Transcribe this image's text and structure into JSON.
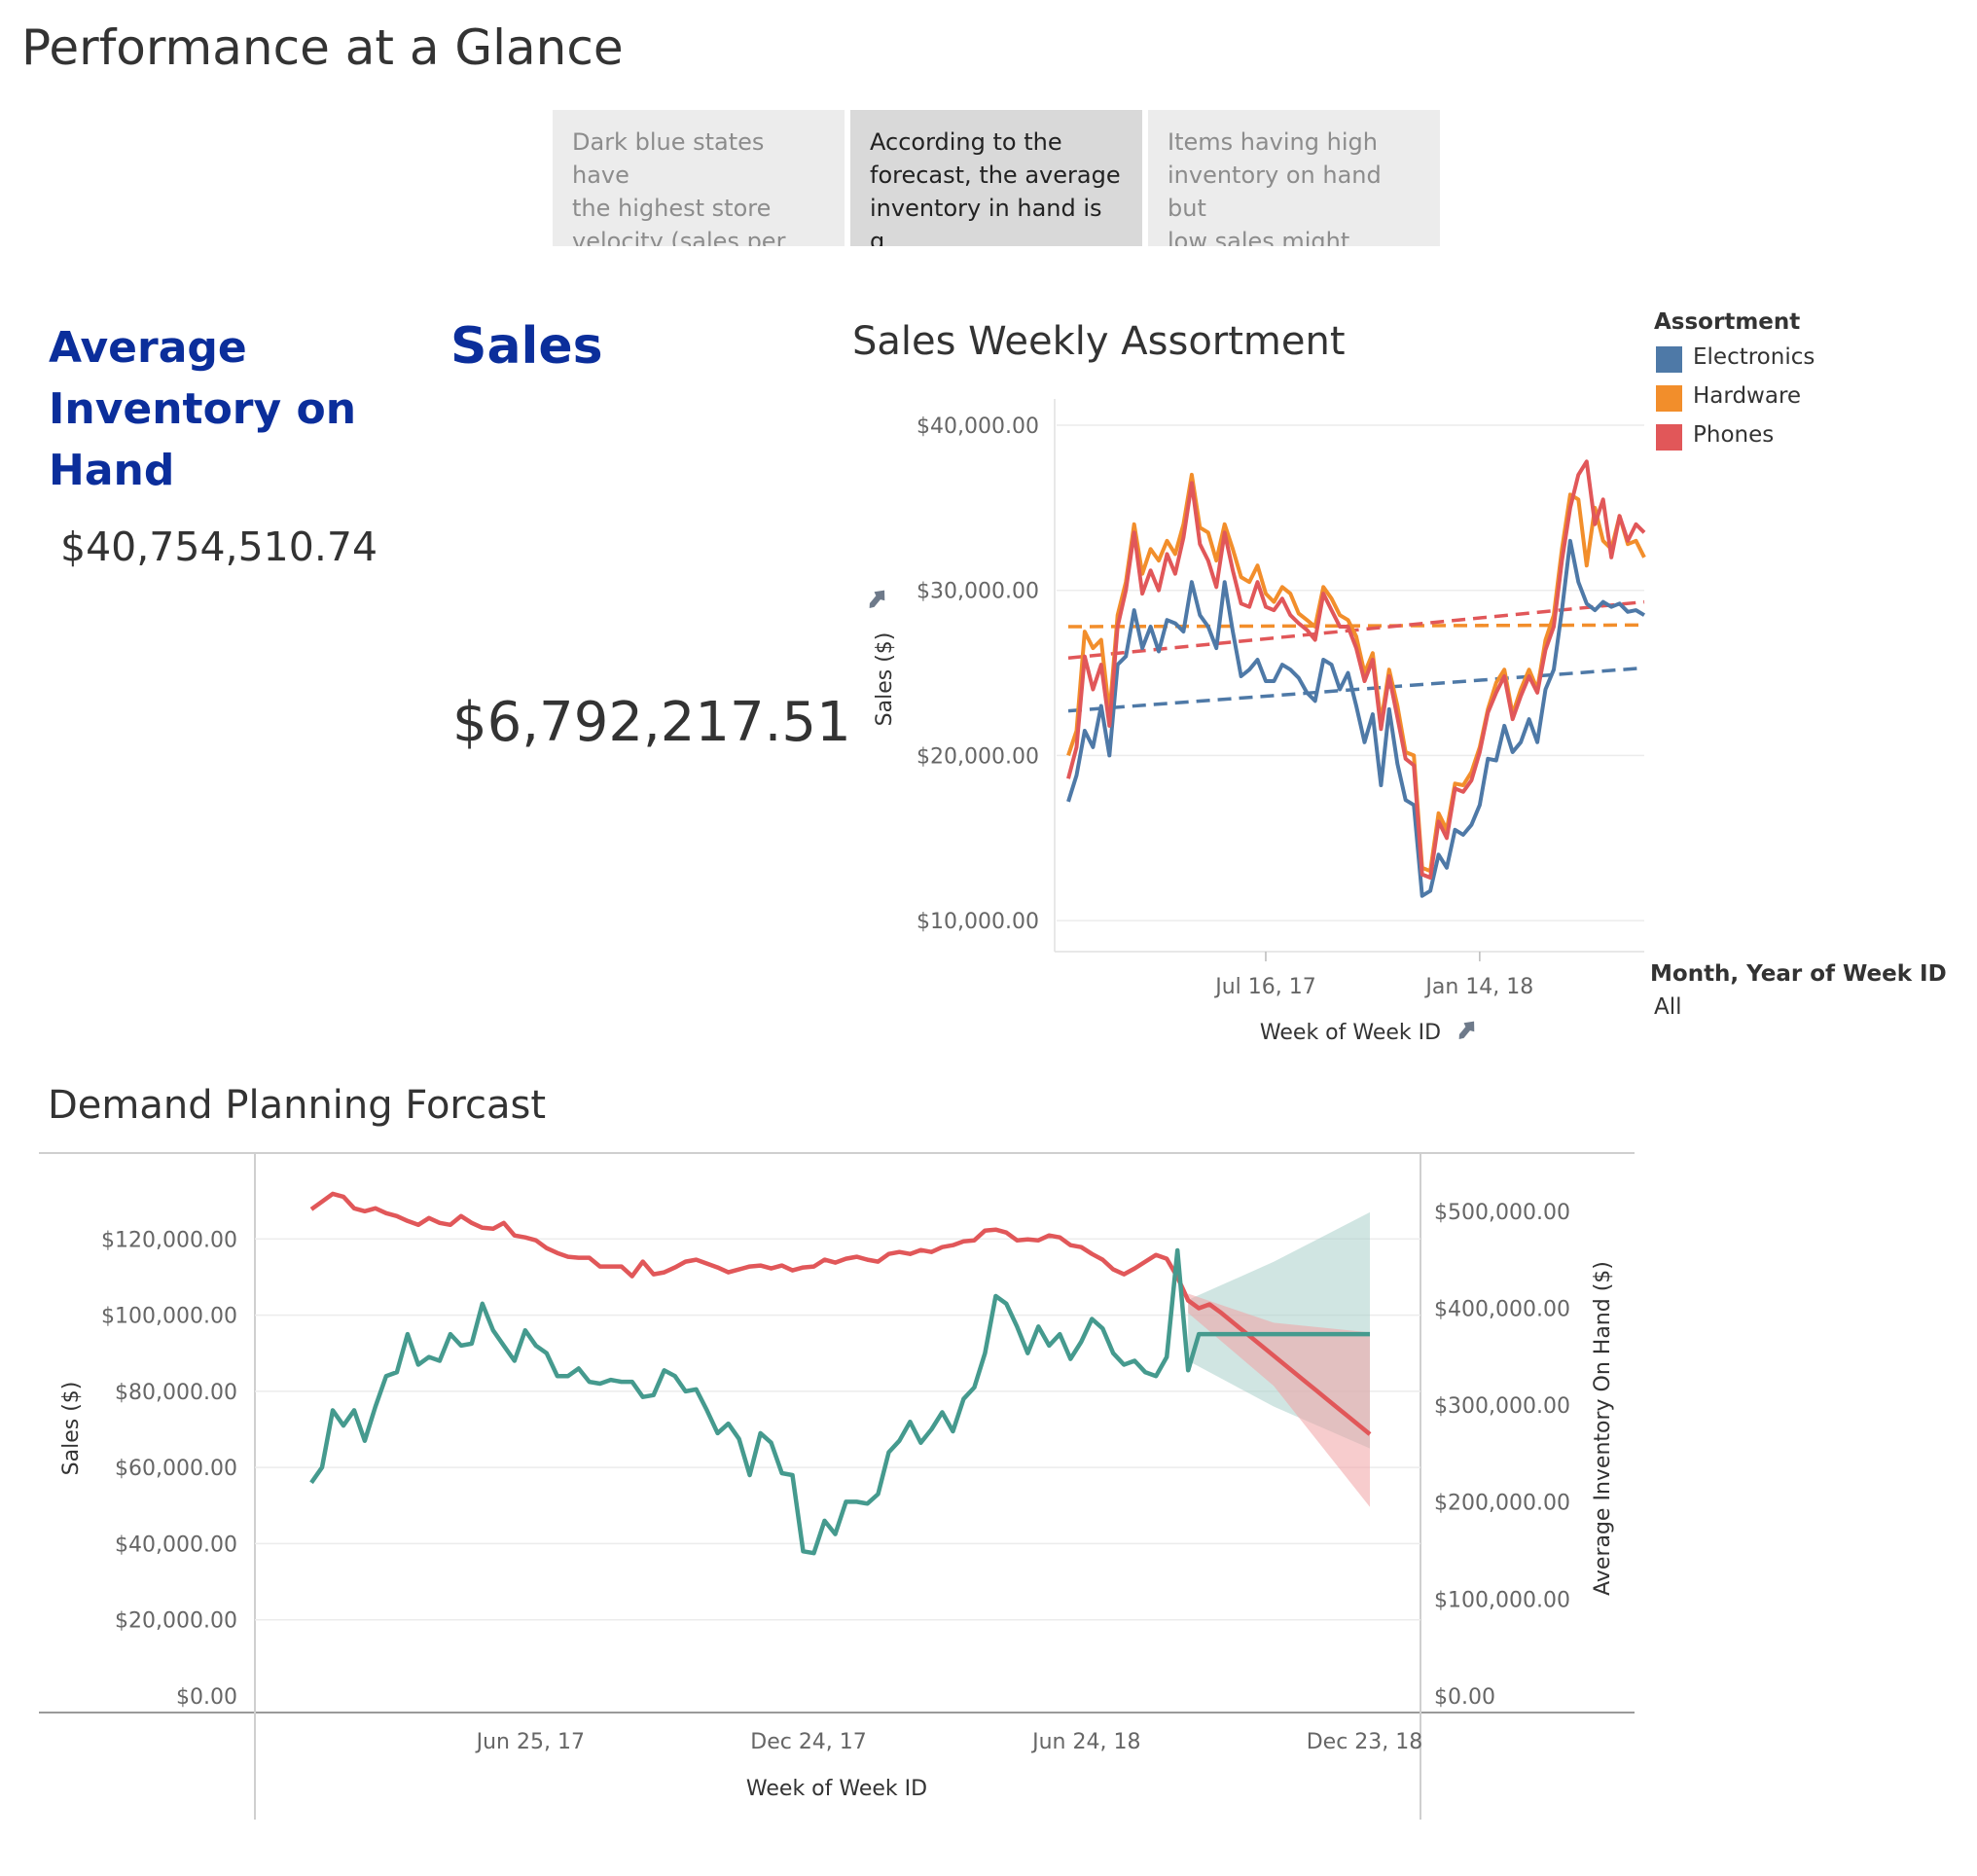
{
  "page_title": "Performance at a Glance",
  "story_points": [
    {
      "text_lines": [
        "Dark blue states have",
        "the highest store",
        "velocity (sales per sto.."
      ],
      "active": false
    },
    {
      "text_lines": [
        "According to the",
        "forecast, the average",
        "inventory in hand is g.."
      ],
      "active": true
    },
    {
      "text_lines": [
        "Items having high",
        "inventory on hand but",
        "low sales might reduc.."
      ],
      "active": false
    }
  ],
  "kpis": {
    "inventory": {
      "title_lines": [
        "Average",
        "Inventory on",
        "Hand"
      ],
      "value": "$40,754,510.74"
    },
    "sales": {
      "title": "Sales",
      "value": "$6,792,217.51"
    }
  },
  "legend": {
    "title": "Assortment",
    "items": [
      {
        "label": "Electronics",
        "color": "#4e79a7"
      },
      {
        "label": "Hardware",
        "color": "#f28e2b"
      },
      {
        "label": "Phones",
        "color": "#e15759"
      }
    ]
  },
  "filter": {
    "title": "Month, Year of Week ID",
    "value": "All"
  },
  "chart_data": [
    {
      "type": "line",
      "title": "Sales Weekly Assortment",
      "xlabel": "Week of Week ID",
      "ylabel": "Sales ($)",
      "ylim": [
        8300,
        41000
      ],
      "y_ticks": [
        10000,
        20000,
        30000,
        40000
      ],
      "y_tick_labels": [
        "$10,000.00",
        "$20,000.00",
        "$30,000.00",
        "$40,000.00"
      ],
      "x_tick_labels": [
        "Jul 16, 17",
        "Jan 14, 18"
      ],
      "x_tick_index": [
        24,
        50
      ],
      "n_weeks": 71,
      "grid": true,
      "legend": "right",
      "series": [
        {
          "name": "Electronics",
          "color": "#4e79a7",
          "values": [
            17200,
            18800,
            21500,
            20500,
            23000,
            20000,
            25500,
            26000,
            28800,
            26500,
            27800,
            26300,
            28200,
            28000,
            27500,
            30500,
            28500,
            27800,
            26500,
            30500,
            27500,
            24800,
            25200,
            25800,
            24500,
            24500,
            25500,
            25200,
            24700,
            23800,
            23300,
            25800,
            25500,
            24000,
            25000,
            23000,
            20800,
            22500,
            18200,
            22800,
            19500,
            17300,
            17000,
            11500,
            11800,
            14000,
            13200,
            15500,
            15200,
            15800,
            17000,
            19800,
            19700,
            21800,
            20200,
            20800,
            22200,
            20800,
            24000,
            25200,
            28800,
            33000,
            30500,
            29200,
            28800,
            29300,
            29000,
            29200,
            28700,
            28800,
            28500
          ],
          "trend": [
            22700,
            25300
          ]
        },
        {
          "name": "Hardware",
          "color": "#f28e2b",
          "values": [
            20000,
            21500,
            27500,
            26500,
            27000,
            22500,
            28500,
            30500,
            34000,
            31000,
            32500,
            31800,
            33000,
            32200,
            34000,
            37000,
            33800,
            33500,
            31800,
            34000,
            32500,
            30800,
            30500,
            31500,
            29800,
            29300,
            30200,
            29800,
            28600,
            28200,
            27800,
            30200,
            29500,
            28500,
            28200,
            27200,
            25000,
            26200,
            22000,
            25200,
            23000,
            20200,
            20000,
            13200,
            13000,
            16500,
            15500,
            18300,
            18200,
            19000,
            20500,
            22800,
            24400,
            25200,
            22500,
            24000,
            25200,
            24000,
            27000,
            28500,
            32500,
            35800,
            35500,
            31500,
            35000,
            33000,
            32500,
            34500,
            32800,
            33000,
            32000
          ],
          "trend": [
            27800,
            27900
          ]
        },
        {
          "name": "Phones",
          "color": "#e15759",
          "values": [
            18600,
            20500,
            26000,
            24000,
            25500,
            21800,
            27800,
            30000,
            33500,
            29800,
            31200,
            30000,
            32200,
            31000,
            33200,
            36500,
            32800,
            31800,
            30200,
            33500,
            31200,
            29200,
            29000,
            30500,
            29000,
            28800,
            29500,
            28500,
            28000,
            27600,
            27000,
            29800,
            28800,
            27800,
            27800,
            26500,
            24500,
            25800,
            21600,
            24800,
            22300,
            19800,
            19400,
            12800,
            12600,
            16000,
            15000,
            18000,
            17800,
            18500,
            20200,
            22600,
            23800,
            24800,
            22200,
            23600,
            24800,
            23800,
            26400,
            27800,
            31800,
            35000,
            37000,
            37800,
            34000,
            35500,
            32000,
            34500,
            33000,
            34000,
            33500
          ],
          "trend": [
            25900,
            29300
          ]
        }
      ]
    },
    {
      "type": "line",
      "title": "Demand Planning Forcast",
      "xlabel": "Week of Week ID",
      "ylabel": "Sales ($)",
      "ylabel_right": "Average Inventory On Hand ($)",
      "ylim": [
        0,
        140000
      ],
      "ylim_right": [
        0,
        550000
      ],
      "y_ticks": [
        0,
        20000,
        40000,
        60000,
        80000,
        100000,
        120000
      ],
      "y_tick_labels": [
        "$0.00",
        "$20,000.00",
        "$40,000.00",
        "$60,000.00",
        "$80,000.00",
        "$100,000.00",
        "$120,000.00"
      ],
      "y_ticks_right": [
        0,
        100000,
        200000,
        300000,
        400000,
        500000
      ],
      "y_tick_labels_right": [
        "$0.00",
        "$100,000.00",
        "$200,000.00",
        "$300,000.00",
        "$400,000.00",
        "$500,000.00"
      ],
      "x_tick_labels": [
        "Jun 25, 17",
        "Dec 24, 17",
        "Jun 24, 18",
        "Dec 23, 18"
      ],
      "x_tick_index": [
        20.5,
        46.5,
        72.5,
        98.5
      ],
      "n_weeks": 100,
      "grid": true,
      "series": [
        {
          "name": "Sales",
          "axis": "left",
          "color": "#459a8e",
          "values": [
            56000,
            60000,
            75000,
            71000,
            75000,
            67000,
            76000,
            84000,
            85000,
            95000,
            87000,
            89000,
            88000,
            95000,
            92000,
            92500,
            103000,
            96000,
            92000,
            88000,
            96000,
            92000,
            90000,
            84000,
            84000,
            86000,
            82500,
            82000,
            83000,
            82500,
            82500,
            78500,
            79000,
            85500,
            84000,
            80000,
            80500,
            75000,
            69000,
            71500,
            67500,
            58000,
            69000,
            66500,
            58500,
            58000,
            38000,
            37500,
            46000,
            42500,
            51000,
            51000,
            50500,
            53000,
            64000,
            67000,
            72000,
            66500,
            70000,
            74500,
            69500,
            78000,
            81000,
            90000,
            105000,
            103000,
            97000,
            90000,
            97000,
            92000,
            95000,
            88500,
            93000,
            99000,
            96500,
            90000,
            87000,
            88000,
            85000,
            84000,
            89000,
            117000,
            85500,
            95000,
            95000,
            95000,
            95000,
            95000,
            95000,
            95000,
            95000,
            95000,
            95000,
            95000,
            95000,
            95000,
            95000,
            95000,
            95000,
            95000
          ],
          "forecast_start_index": 83,
          "band_upper": [
            [
              82,
              104000
            ],
            [
              90,
              114000
            ],
            [
              99,
              127000
            ]
          ],
          "band_lower": [
            [
              82,
              88000
            ],
            [
              90,
              76000
            ],
            [
              99,
              65000
            ]
          ]
        },
        {
          "name": "Average Inventory On Hand",
          "axis": "right",
          "color": "#e15759",
          "values": [
            502000,
            510000,
            518000,
            515000,
            503000,
            500000,
            503000,
            498000,
            495000,
            490000,
            486000,
            493000,
            488000,
            486000,
            495000,
            488000,
            483000,
            482000,
            488000,
            475000,
            473000,
            470000,
            462000,
            457000,
            453000,
            452000,
            452000,
            443000,
            443000,
            443000,
            433000,
            448000,
            435000,
            437000,
            442000,
            448000,
            450000,
            446000,
            442000,
            437000,
            440000,
            443000,
            444000,
            441000,
            444000,
            439000,
            442000,
            443000,
            450000,
            447000,
            451000,
            453000,
            450000,
            448000,
            456000,
            458000,
            456000,
            460000,
            458000,
            463000,
            465000,
            469000,
            470000,
            480000,
            481000,
            478000,
            470000,
            471000,
            470000,
            475000,
            473000,
            465000,
            463000,
            456000,
            450000,
            440000,
            435000,
            441000,
            448000,
            455000,
            451000,
            432000,
            408000,
            400000,
            404000,
            396000,
            387000,
            378000,
            369000,
            360000,
            351000,
            342000,
            333000,
            324000,
            315000,
            306000,
            297000,
            288000,
            279000,
            270000
          ],
          "forecast_start_index": 83,
          "band_upper": [
            [
              82,
              415000
            ],
            [
              90,
              385000
            ],
            [
              99,
              375000
            ]
          ],
          "band_lower": [
            [
              82,
              395000
            ],
            [
              90,
              320000
            ],
            [
              99,
              195000
            ]
          ]
        }
      ]
    }
  ]
}
